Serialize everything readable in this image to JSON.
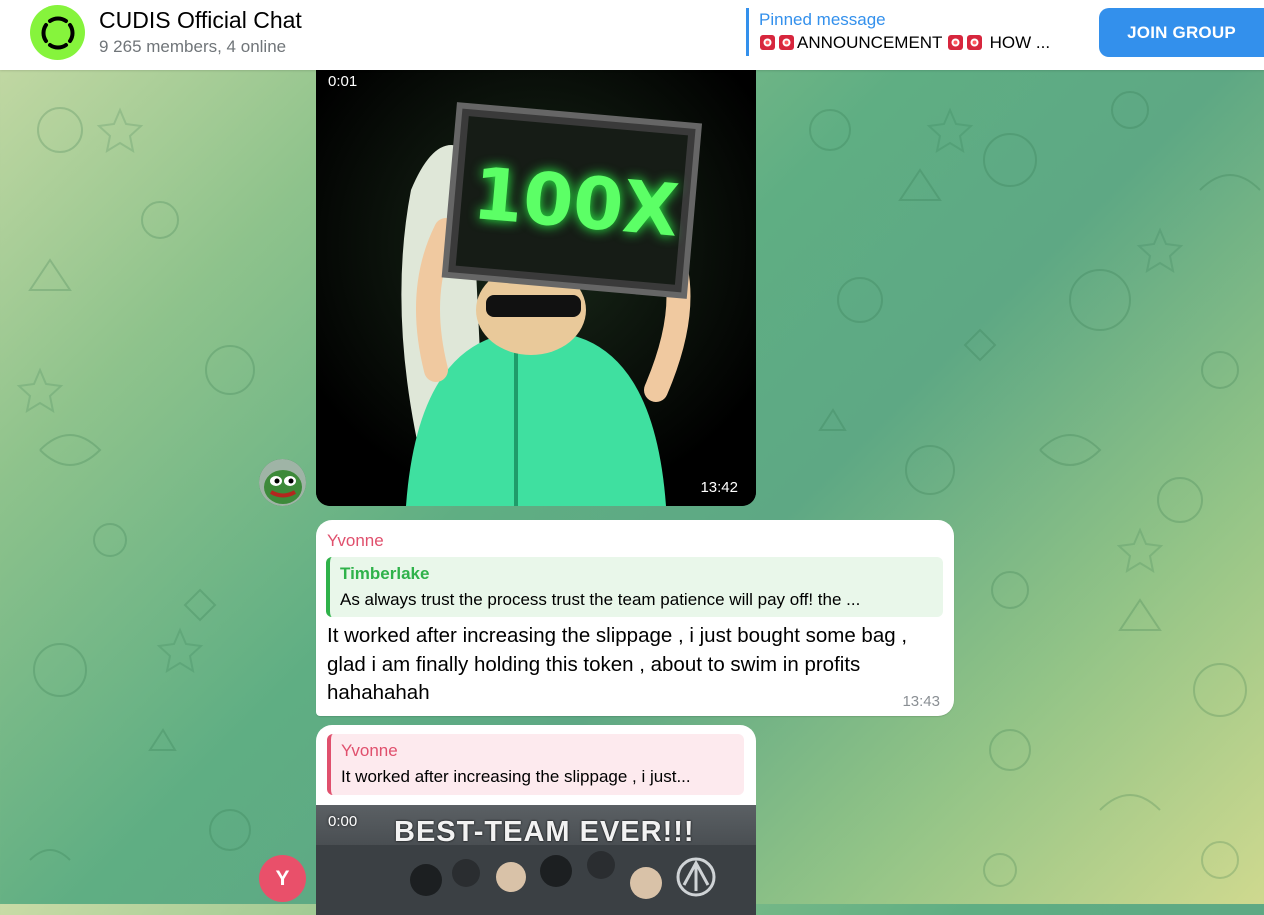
{
  "header": {
    "title": "CUDIS Official Chat",
    "subtitle": "9 265 members, 4 online",
    "avatar_icon": "cudis-logo-icon",
    "avatar_color": "#86f43c"
  },
  "pinned": {
    "label": "Pinned message",
    "text_part1": "ANNOUNCEMENT",
    "text_part2": "HOW ..."
  },
  "join_button": {
    "label": "JOIN GROUP",
    "color": "#3390ec"
  },
  "messages": [
    {
      "type": "video",
      "duration": "0:01",
      "time": "13:42",
      "sign_text": "100X",
      "avatar_icon": "pepe-avatar-icon"
    },
    {
      "type": "text",
      "sender": "Yvonne",
      "reply_to": {
        "name": "Timberlake",
        "text": "As always trust the process trust the team patience will pay off! the ..."
      },
      "text": "It worked after increasing the slippage , i just bought some bag , glad i am finally holding this token , about to swim in profits hahahahah",
      "time": "13:43"
    },
    {
      "type": "video",
      "reply_to": {
        "name": "Yvonne",
        "text": "It worked after increasing the slippage , i just..."
      },
      "duration": "0:00",
      "caption": "BEST-TEAM EVER!!!",
      "avatar_letter": "Y"
    }
  ],
  "colors": {
    "accent": "#3390ec",
    "sender_pink": "#e0506d",
    "reply_green": "#2fb24a"
  }
}
